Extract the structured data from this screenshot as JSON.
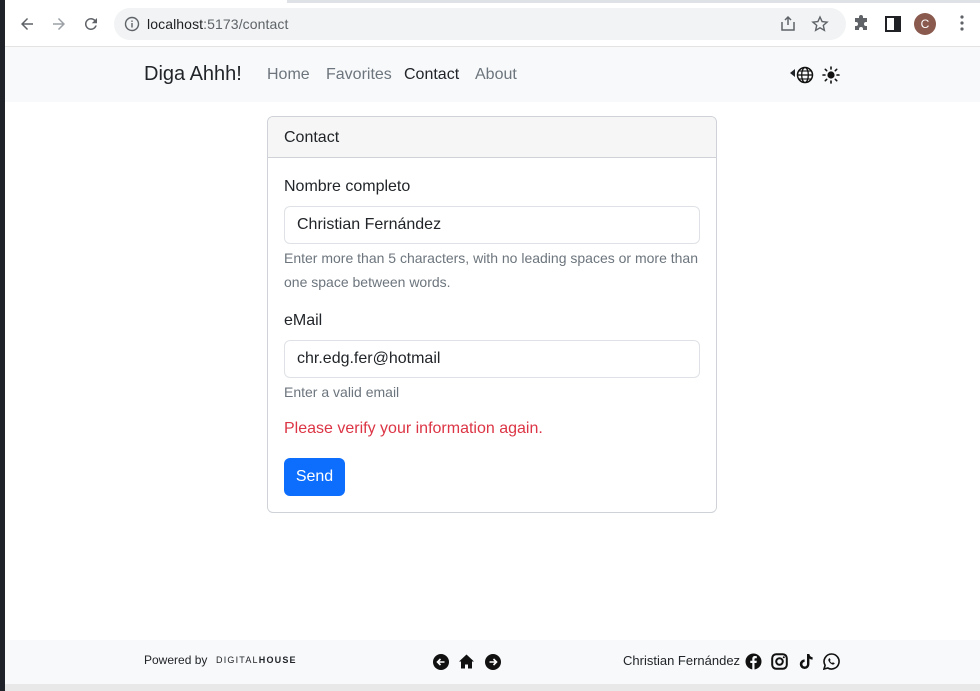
{
  "browser": {
    "url_host": "localhost",
    "url_path": ":5173/contact",
    "avatar_letter": "C"
  },
  "navbar": {
    "brand": "Diga Ahhh!",
    "links": [
      {
        "label": "Home",
        "active": false
      },
      {
        "label": "Favorites",
        "active": false
      },
      {
        "label": "Contact",
        "active": true
      },
      {
        "label": "About",
        "active": false
      }
    ],
    "icons": [
      "chevron-left-icon",
      "globe-icon",
      "sun-icon"
    ]
  },
  "card": {
    "header": "Contact",
    "name_label": "Nombre completo",
    "name_value": "Christian Fernández",
    "name_help": "Enter more than 5 characters, with no leading spaces or more than one space between words.",
    "email_label": "eMail",
    "email_value": "chr.edg.fer@hotmail",
    "email_help": "Enter a valid email",
    "error": "Please verify your information again.",
    "send_label": "Send"
  },
  "footer": {
    "powered_by": "Powered by",
    "logo_light": "DIGITAL",
    "logo_bold": "HOUSE",
    "author": "Christian Fernández",
    "nav_icons": [
      "arrow-left-circle-icon",
      "home-icon",
      "arrow-right-circle-icon"
    ],
    "social_icons": [
      "facebook-icon",
      "instagram-icon",
      "tiktok-icon",
      "whatsapp-icon"
    ]
  },
  "colors": {
    "primary": "#0d6efd",
    "danger": "#dc3545",
    "muted": "#6c757d",
    "navbar_bg": "#f8f9fa"
  }
}
